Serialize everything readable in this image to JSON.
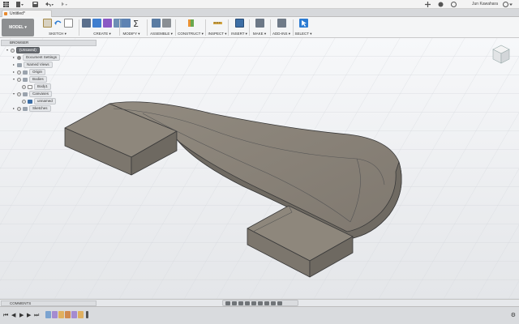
{
  "topbar": {
    "user_name": "Jun Kawahara",
    "icons": [
      "apps-grid-icon",
      "file-menu-icon",
      "save-icon",
      "undo-icon",
      "redo-icon",
      "plus-icon",
      "extensions-icon",
      "notifications-icon",
      "help-icon"
    ]
  },
  "document": {
    "tab_title": "Untitled*"
  },
  "toolbar": {
    "workspace": "MODEL",
    "groups": [
      {
        "label": "SKETCH"
      },
      {
        "label": "CREATE"
      },
      {
        "label": "MODIFY"
      },
      {
        "label": "ASSEMBLE"
      },
      {
        "label": "CONSTRUCT"
      },
      {
        "label": "INSPECT"
      },
      {
        "label": "INSERT"
      },
      {
        "label": "MAKE"
      },
      {
        "label": "ADD-INS"
      },
      {
        "label": "SELECT"
      }
    ]
  },
  "browser": {
    "header": "BROWSER",
    "root": "(Unsaved)",
    "items": [
      {
        "label": "Document Settings"
      },
      {
        "label": "Named Views"
      },
      {
        "label": "Origin"
      },
      {
        "label": "Bodies"
      },
      {
        "label": "Body1"
      },
      {
        "label": "Canvases"
      },
      {
        "label": "unnamed"
      },
      {
        "label": "Sketches"
      }
    ]
  },
  "comments": {
    "label": "COMMENTS"
  },
  "colors": {
    "accent": "#2b7bd2",
    "body_fill": "#8b857c",
    "body_edge": "#3a3a3a",
    "toolbar_bg": "#f4f5f6"
  }
}
